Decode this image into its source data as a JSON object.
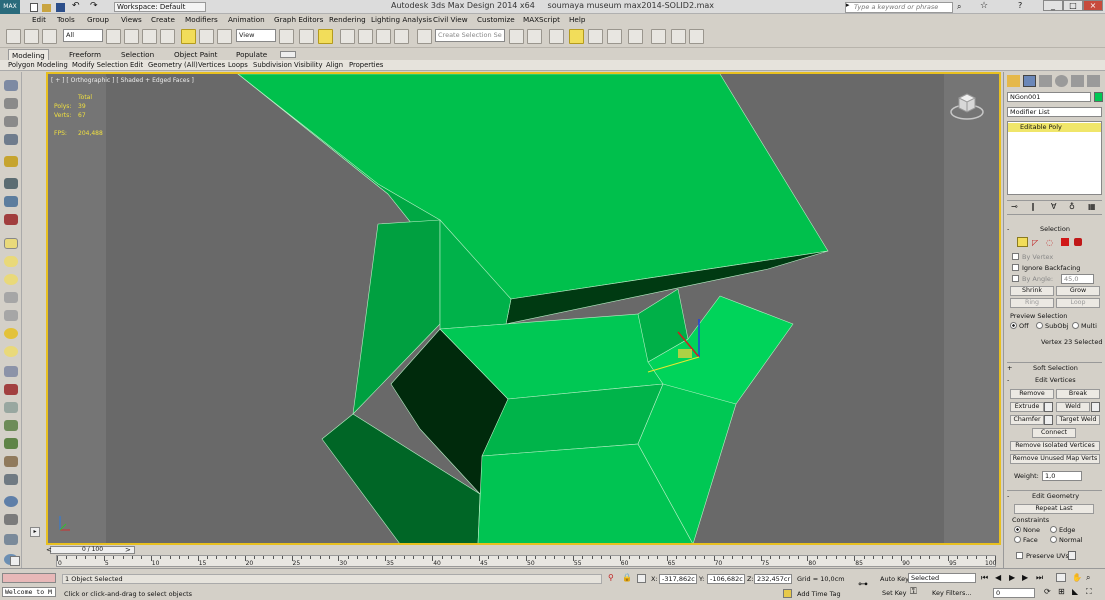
{
  "titlebar": {
    "workspace": "Workspace: Default",
    "title": "Autodesk 3ds Max Design 2014 x64     soumaya museum max2014-SOLID2.max",
    "search_placeholder": "Type a keyword or phrase",
    "min": "_",
    "max": "□",
    "close": "×"
  },
  "menu": [
    "Edit",
    "Tools",
    "Group",
    "Views",
    "Create",
    "Modifiers",
    "Animation",
    "Graph Editors",
    "Rendering",
    "Lighting Analysis",
    "Civil View",
    "Customize",
    "MAXScript",
    "Help"
  ],
  "toolbar": {
    "filter": "All",
    "coord": "View",
    "named_sel": "Create Selection Se"
  },
  "ribbon": {
    "tabs": [
      "Modeling",
      "Freeform",
      "Selection",
      "Object Paint",
      "Populate"
    ],
    "sub": [
      "Polygon Modeling",
      "Modify Selection",
      "Edit",
      "Geometry (All)",
      "Vertices",
      "Loops",
      "Subdivision",
      "Visibility",
      "Align",
      "Properties"
    ]
  },
  "viewport": {
    "label": "[ + ] [ Orthographic ] [ Shaded + Edged Faces ]",
    "total": "Total",
    "polys_label": "Polys:",
    "polys": "39",
    "verts_label": "Verts:",
    "verts": "67",
    "fps_label": "FPS:",
    "fps": "204,488",
    "colors": {
      "bg": "#696969",
      "green": "#00c854",
      "dark": "#003a12",
      "mid": "#009a3c"
    }
  },
  "panel": {
    "object": "NGon001",
    "modifier_list": "Modifier List",
    "stack_item": "Editable Poly",
    "selection": {
      "title": "Selection",
      "by_vertex": "By Vertex",
      "ignore_backfacing": "Ignore Backfacing",
      "by_angle": "By Angle:",
      "angle": "45,0",
      "shrink": "Shrink",
      "grow": "Grow",
      "ring": "Ring",
      "loop": "Loop",
      "preview": "Preview Selection",
      "off": "Off",
      "subobj": "SubObj",
      "multi": "Multi",
      "status": "Vertex 23 Selected"
    },
    "soft_selection": "Soft Selection",
    "edit_vertices": {
      "title": "Edit Vertices",
      "remove": "Remove",
      "break": "Break",
      "extrude": "Extrude",
      "weld": "Weld",
      "chamfer": "Chamfer",
      "target_weld": "Target Weld",
      "connect": "Connect",
      "remove_isolated": "Remove Isolated Vertices",
      "remove_unused": "Remove Unused Map Verts",
      "weight_label": "Weight:",
      "weight": "1,0"
    },
    "edit_geometry": {
      "title": "Edit Geometry",
      "repeat_last": "Repeat Last",
      "constraints": "Constraints",
      "none": "None",
      "edge": "Edge",
      "face": "Face",
      "normal": "Normal",
      "preserve_uvs": "Preserve UVs"
    }
  },
  "timeline": {
    "frame": "0 / 100",
    "ticks": [
      "0",
      "5",
      "10",
      "15",
      "20",
      "25",
      "30",
      "35",
      "40",
      "45",
      "50",
      "55",
      "60",
      "65",
      "70",
      "75",
      "80",
      "85",
      "90",
      "95",
      "100"
    ]
  },
  "status": {
    "maxscript": "Welcome to M",
    "objects": "1 Object Selected",
    "prompt": "Click or click-and-drag to select objects",
    "x_label": "X:",
    "x": "-317,862c",
    "y_label": "Y:",
    "y": "-106,682c",
    "z_label": "Z:",
    "z": "232,457cr",
    "grid": "Grid = 10,0cm",
    "add_time_tag": "Add Time Tag",
    "auto_key": "Auto Key",
    "selected": "Selected",
    "set_key": "Set Key",
    "key_filters": "Key Filters...",
    "frame_field": "0"
  }
}
